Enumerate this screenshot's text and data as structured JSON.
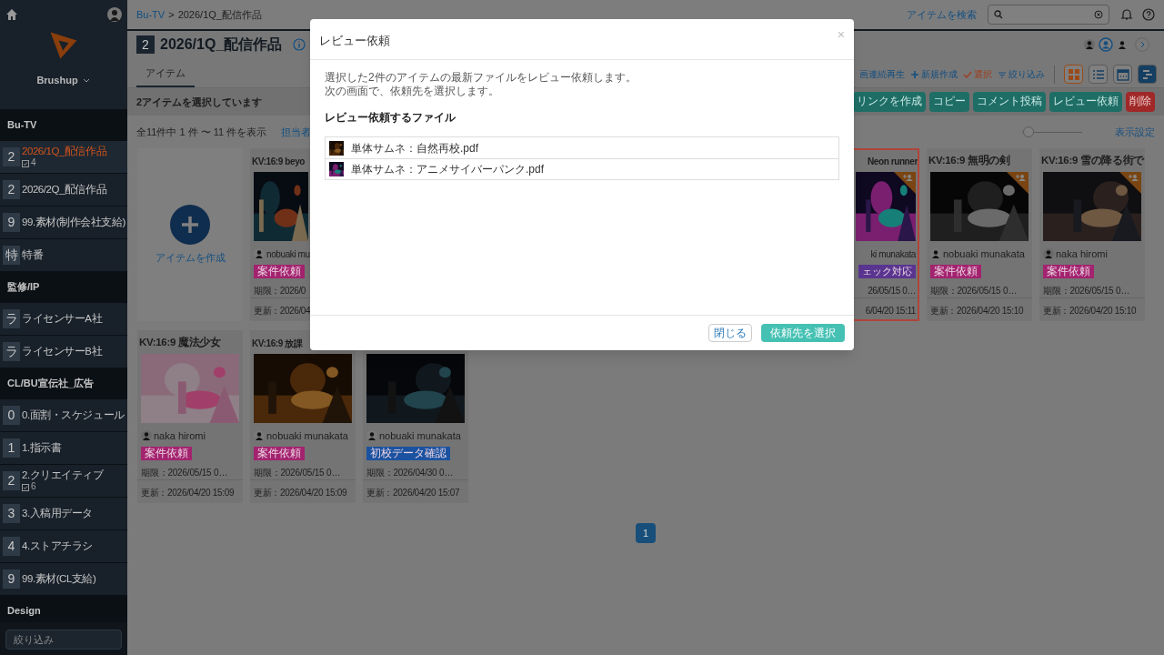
{
  "sidebar": {
    "brand": "Brushup",
    "filter_placeholder": "絞り込み",
    "sections": [
      {
        "title": "Bu-TV",
        "items": [
          {
            "badge": "2",
            "label": "2026/1Q_配信作品",
            "count": "4",
            "selected": true
          },
          {
            "badge": "2",
            "label": "2026/2Q_配信作品",
            "selected": false
          },
          {
            "badge": "9",
            "label": "99.素材(制作会社支給)",
            "selected": false
          },
          {
            "badge": "特",
            "label": "特番",
            "selected": false
          }
        ]
      },
      {
        "title": "監修/IP",
        "items": [
          {
            "badge": "ラ",
            "label": "ライセンサーA社",
            "selected": false
          },
          {
            "badge": "ラ",
            "label": "ライセンサーB社",
            "selected": false
          }
        ]
      },
      {
        "title": "CL/BU宣伝社_広告",
        "items": [
          {
            "badge": "0",
            "label": "0.面割・スケジュール",
            "selected": false
          },
          {
            "badge": "1",
            "label": "1.指示書",
            "selected": false
          },
          {
            "badge": "2",
            "label": "2.クリエイティブ",
            "count": "6",
            "selected": false
          },
          {
            "badge": "3",
            "label": "3.入稿用データ",
            "selected": false
          },
          {
            "badge": "4",
            "label": "4.ストアチラシ",
            "selected": false
          },
          {
            "badge": "9",
            "label": "99.素材(CL支給)",
            "selected": false
          }
        ]
      },
      {
        "title": "Design"
      }
    ]
  },
  "breadcrumb": {
    "link": "Bu-TV",
    "separator": ">",
    "current": "2026/1Q_配信作品"
  },
  "search": {
    "link": "アイテムを検索"
  },
  "title": {
    "badge": "2",
    "text": "2026/1Q_配信作品"
  },
  "tabs": [
    {
      "label": "アイテム",
      "selected": true
    }
  ],
  "toolbar": [
    {
      "kind": "play",
      "label": "画連続再生",
      "selected": false
    },
    {
      "kind": "plus",
      "label": "新規作成",
      "selected": false
    },
    {
      "kind": "check",
      "label": "選択",
      "selected": true
    },
    {
      "kind": "filter",
      "label": "絞り込み",
      "selected": false
    }
  ],
  "views": [
    {
      "kind": "grid",
      "selected": true
    },
    {
      "kind": "list",
      "selected": false
    },
    {
      "kind": "calendar",
      "selected": false
    },
    {
      "kind": "gantt",
      "selected": false
    }
  ],
  "selection_text": "2アイテムを選択しています",
  "actions": [
    {
      "label": "リンクを作成",
      "kind": "normal"
    },
    {
      "label": "コピー",
      "kind": "normal"
    },
    {
      "label": "コメント投稿",
      "kind": "normal"
    },
    {
      "label": "レビュー依頼",
      "kind": "normal"
    },
    {
      "label": "削除",
      "kind": "danger"
    }
  ],
  "count_text": "全11件中 1 件 〜 11 件を表示",
  "assignee_link": "担当者",
  "display_settings": "表示設定",
  "zoom_slider": {
    "level": 0.1
  },
  "create_card": {
    "label": "アイテムを作成"
  },
  "rows": [
    [
      {
        "kind": "cut_right",
        "title": "KV:16:9 beyo",
        "author": "nobuaki mu",
        "tag": "案件依頼",
        "color": "#a3236f",
        "due": "期限：2026/0",
        "updated": "更新：2026/04",
        "selected": false,
        "corner_badge": false
      },
      {
        "kind": "hidden"
      },
      {
        "kind": "hidden"
      },
      {
        "kind": "hidden"
      },
      {
        "kind": "hidden"
      },
      {
        "kind": "cut_left",
        "title": "Neon runner",
        "author": "ki munakata",
        "tag": "ェック対応",
        "color": "#5a3590",
        "due": "26/05/15 0…",
        "updated": "6/04/20 15:11",
        "selected": true,
        "corner_badge": true
      },
      {
        "kind": "full",
        "title": "KV:16:9 無明の剣",
        "author": "nobuaki munakata",
        "tag": "案件依頼",
        "color": "#a3236f",
        "due": "期限：2026/05/15 0…",
        "updated": "更新：2026/04/20 15:10",
        "selected": false,
        "corner_badge": true
      },
      {
        "kind": "full",
        "title": "KV:16:9 雪の降る街で",
        "author": "naka hiromi",
        "tag": "案件依頼",
        "color": "#a3236f",
        "due": "期限：2026/05/15 0…",
        "updated": "更新：2026/04/20 15:10",
        "selected": false,
        "corner_badge": true
      }
    ],
    [
      {
        "kind": "full",
        "title": "KV:16:9 魔法少女",
        "author": "naka hiromi",
        "tag": "案件依頼",
        "color": "#a3236f",
        "due": "期限：2026/05/15 0…",
        "updated": "更新：2026/04/20 15:09",
        "selected": false,
        "corner_badge": false
      },
      {
        "kind": "title_cut",
        "title": "KV:16:9 放課",
        "author": "nobuaki munakata",
        "tag": "案件依頼",
        "color": "#a3236f",
        "due": "期限：2026/05/15 0…",
        "updated": "更新：2026/04/20 15:09",
        "selected": false,
        "corner_badge": false
      },
      {
        "kind": "untitled",
        "author": "nobuaki munakata",
        "tag": "初校データ確認",
        "color": "#1a52a0",
        "due": "期限：2026/04/30 0…",
        "updated": "更新：2026/04/20 15:07",
        "selected": false,
        "corner_badge": false
      }
    ]
  ],
  "pagination": [
    {
      "label": "1",
      "selected": true
    }
  ],
  "dialog": {
    "title": "レビュー依頼",
    "close": "×",
    "lines": [
      "選択した2件のアイテムの最新ファイルをレビュー依頼します。",
      "次の画面で、依頼先を選択します。"
    ],
    "heading": "レビュー依頼するファイル",
    "files": [
      {
        "name": "単体サムネ：自然再校.pdf"
      },
      {
        "name": "単体サムネ：アニメサイバーパンク.pdf"
      }
    ],
    "buttons": [
      {
        "label": "閉じる",
        "kind": "secondary"
      },
      {
        "label": "依頼先を選択",
        "kind": "primary"
      }
    ]
  }
}
